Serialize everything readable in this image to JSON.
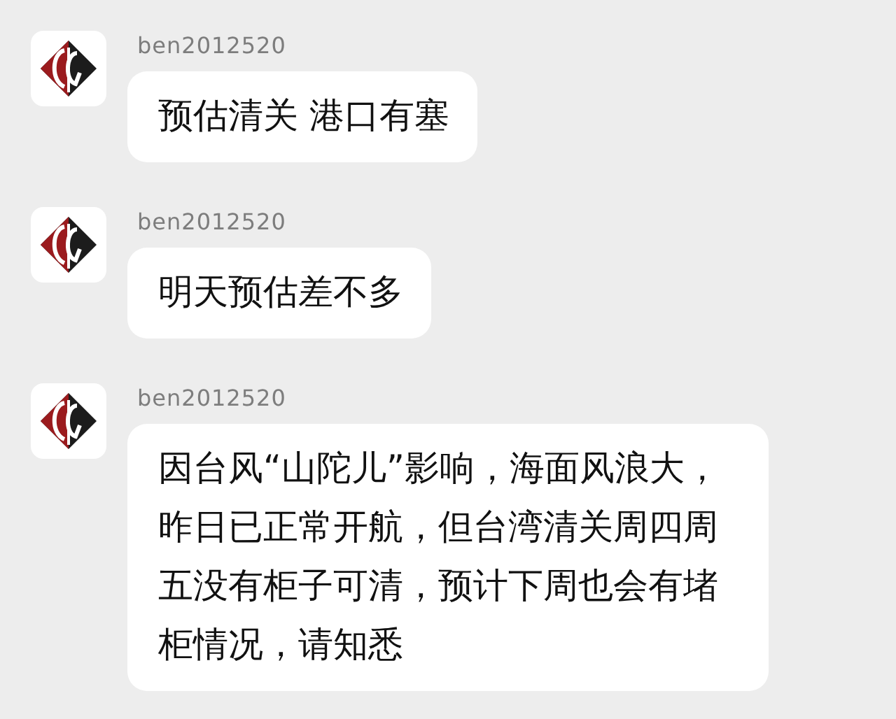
{
  "messages": [
    {
      "sender": "ben2012520",
      "text": "预估清关 港口有塞"
    },
    {
      "sender": "ben2012520",
      "text": "明天预估差不多"
    },
    {
      "sender": "ben2012520",
      "text": "因台风“山陀儿”影响，海面风浪大，昨日已正常开航，但台湾清关周四周五没有柜子可清，预计下周也会有堵柜情况，请知悉"
    }
  ]
}
